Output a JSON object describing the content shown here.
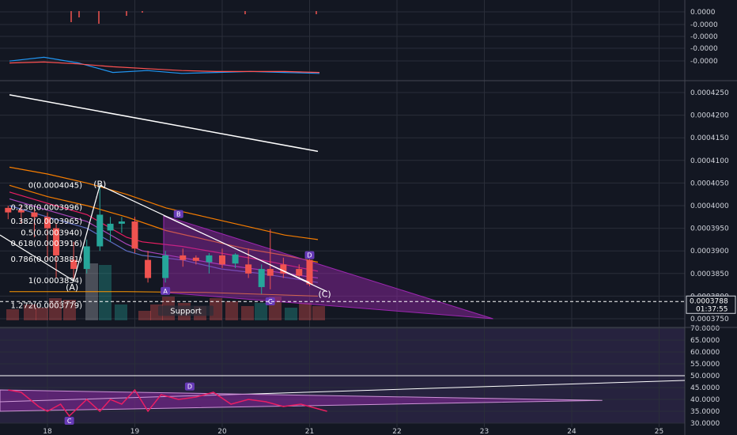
{
  "colors": {
    "background": "#131722",
    "grid": "#2a2e39",
    "axis_text": "#d1d4dc",
    "up_candle": "#26a69a",
    "down_candle": "#ef5350",
    "wedge": "#9c27b0",
    "rsi_band": "#7e57c2",
    "orange_band": "#f57c00",
    "magenta": "#e91e63",
    "purple": "#ab47bc",
    "white": "#ffffff"
  },
  "chart_data": [
    {
      "type": "line",
      "panel": "macd",
      "y_ticks": [
        "0.0000",
        "-0.0000",
        "-0.0000",
        "-0.0000",
        "-0.0000"
      ],
      "series": [
        {
          "color": "#2196f3",
          "values": [
            0.4,
            0.8,
            0.2,
            -0.8,
            -0.6,
            -0.9,
            -0.8,
            -0.7,
            -0.8,
            -0.9
          ]
        },
        {
          "color": "#ff5252",
          "values": [
            0.2,
            0.3,
            0.1,
            -0.2,
            -0.4,
            -0.6,
            -0.7,
            -0.7,
            -0.7,
            -0.8
          ]
        }
      ]
    },
    {
      "type": "candlestick",
      "panel": "price",
      "x_ticks": [
        "18",
        "19",
        "20",
        "21",
        "22",
        "23",
        "24",
        "25"
      ],
      "y_ticks": [
        "0.0004250",
        "0.0004200",
        "0.0004150",
        "0.0004100",
        "0.0004050",
        "0.0004000",
        "0.0003950",
        "0.0003900",
        "0.0003850",
        "0.0003800",
        "0.0003750"
      ],
      "ylim": [
        0.000374,
        0.000427
      ],
      "last_price": "0.0003788",
      "countdown": "01:37:55",
      "candles": [
        {
          "x": 17.55,
          "o": 0.0003995,
          "h": 0.0004,
          "l": 0.000397,
          "c": 0.0003985
        },
        {
          "x": 17.7,
          "o": 0.000399,
          "h": 0.0004,
          "l": 0.000396,
          "c": 0.0003985
        },
        {
          "x": 17.85,
          "o": 0.0003985,
          "h": 0.0003995,
          "l": 0.000393,
          "c": 0.0003975
        },
        {
          "x": 18.0,
          "o": 0.0003975,
          "h": 0.0003985,
          "l": 0.000388,
          "c": 0.000395
        },
        {
          "x": 18.1,
          "o": 0.000395,
          "h": 0.000396,
          "l": 0.000384,
          "c": 0.000389
        },
        {
          "x": 18.3,
          "o": 0.000388,
          "h": 0.000392,
          "l": 0.0003838,
          "c": 0.000386
        },
        {
          "x": 18.45,
          "o": 0.000386,
          "h": 0.0003925,
          "l": 0.000385,
          "c": 0.000391
        },
        {
          "x": 18.6,
          "o": 0.000391,
          "h": 0.0004045,
          "l": 0.00039,
          "c": 0.000398
        },
        {
          "x": 18.72,
          "o": 0.0003945,
          "h": 0.0003975,
          "l": 0.000392,
          "c": 0.000396
        },
        {
          "x": 18.85,
          "o": 0.000396,
          "h": 0.0003975,
          "l": 0.000394,
          "c": 0.0003965
        },
        {
          "x": 19.0,
          "o": 0.0003965,
          "h": 0.0003975,
          "l": 0.0003895,
          "c": 0.0003905
        },
        {
          "x": 19.15,
          "o": 0.000388,
          "h": 0.00039,
          "l": 0.000383,
          "c": 0.000384
        },
        {
          "x": 19.35,
          "o": 0.000384,
          "h": 0.00039,
          "l": 0.000383,
          "c": 0.000389
        },
        {
          "x": 19.55,
          "o": 0.000389,
          "h": 0.0003905,
          "l": 0.0003865,
          "c": 0.000388
        },
        {
          "x": 19.7,
          "o": 0.0003885,
          "h": 0.000389,
          "l": 0.000387,
          "c": 0.0003878
        },
        {
          "x": 19.85,
          "o": 0.0003875,
          "h": 0.0003895,
          "l": 0.000385,
          "c": 0.000389
        },
        {
          "x": 20.0,
          "o": 0.000389,
          "h": 0.0003905,
          "l": 0.0003862,
          "c": 0.000387
        },
        {
          "x": 20.15,
          "o": 0.0003872,
          "h": 0.0003895,
          "l": 0.0003862,
          "c": 0.0003892
        },
        {
          "x": 20.3,
          "o": 0.000387,
          "h": 0.0003905,
          "l": 0.000384,
          "c": 0.000385
        },
        {
          "x": 20.45,
          "o": 0.000382,
          "h": 0.000387,
          "l": 0.0003805,
          "c": 0.000386
        },
        {
          "x": 20.55,
          "o": 0.000386,
          "h": 0.0003948,
          "l": 0.0003815,
          "c": 0.0003845
        },
        {
          "x": 20.7,
          "o": 0.000387,
          "h": 0.0003885,
          "l": 0.000384,
          "c": 0.000385
        },
        {
          "x": 20.88,
          "o": 0.000386,
          "h": 0.000387,
          "l": 0.000384,
          "c": 0.0003845
        },
        {
          "x": 21.0,
          "o": 0.000388,
          "h": 0.0003885,
          "l": 0.0003822,
          "c": 0.0003826
        }
      ]
    },
    {
      "type": "line",
      "panel": "rsi",
      "y_ticks": [
        "70.0000",
        "65.0000",
        "60.0000",
        "55.0000",
        "50.0000",
        "45.0000",
        "40.0000",
        "35.0000",
        "30.0000"
      ],
      "ylim": [
        29.5,
        71.5
      ],
      "series": [
        {
          "color": "#e91e63",
          "x": [
            17.55,
            17.7,
            17.9,
            18.0,
            18.15,
            18.25,
            18.45,
            18.6,
            18.72,
            18.85,
            19.0,
            19.15,
            19.3,
            19.5,
            19.7,
            19.9,
            20.1,
            20.3,
            20.5,
            20.7,
            20.9,
            21.0,
            21.2
          ],
          "values": [
            44,
            43,
            37,
            35,
            38,
            33,
            40,
            35,
            40,
            38,
            44,
            35,
            42,
            40,
            41,
            43,
            38,
            40,
            39,
            37,
            38,
            37,
            35
          ]
        }
      ]
    }
  ],
  "fib_labels": [
    {
      "text": "0(0.0004045)"
    },
    {
      "text": "0.236(0.0003996)"
    },
    {
      "text": "0.382(0.0003965)"
    },
    {
      "text": "0.5(0.0003940)"
    },
    {
      "text": "0.618(0.0003916)"
    },
    {
      "text": "0.786(0.0003881)"
    },
    {
      "text": "1(0.0003834)"
    },
    {
      "text": "1.272(0.0003779)"
    }
  ],
  "wave_labels": {
    "a": "(A)",
    "b": "(B)",
    "c": "(C)"
  },
  "badges": {
    "a": "A",
    "b": "B",
    "c": "C",
    "d": "D",
    "rsi_c": "C",
    "rsi_d": "D"
  },
  "support_label": "Support"
}
